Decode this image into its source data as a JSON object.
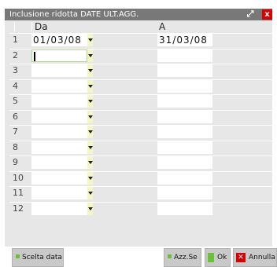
{
  "window": {
    "title": "Inclusione ridotta DATE ULT.AGG.",
    "maximize_glyph": "⤢",
    "close_glyph": "x"
  },
  "columns": {
    "da": "Da",
    "a": "A"
  },
  "rows": [
    {
      "num": "1",
      "da": "01/03/08",
      "a": "31/03/08"
    },
    {
      "num": "2",
      "da": "",
      "a": ""
    },
    {
      "num": "3",
      "da": "",
      "a": ""
    },
    {
      "num": "4",
      "da": "",
      "a": ""
    },
    {
      "num": "5",
      "da": "",
      "a": ""
    },
    {
      "num": "6",
      "da": "",
      "a": ""
    },
    {
      "num": "7",
      "da": "",
      "a": ""
    },
    {
      "num": "8",
      "da": "",
      "a": ""
    },
    {
      "num": "9",
      "da": "",
      "a": ""
    },
    {
      "num": "10",
      "da": "",
      "a": ""
    },
    {
      "num": "11",
      "da": "",
      "a": ""
    },
    {
      "num": "12",
      "da": "",
      "a": ""
    }
  ],
  "buttons": {
    "scelta_data": "Scelta data",
    "azz_se": "Azz.Se",
    "ok": "Ok",
    "annulla": "Annulla"
  },
  "colors": {
    "titlebar": "#787878",
    "panel": "#e7e7e7",
    "accent_green": "#6bbf3a",
    "close_red": "#d80000"
  }
}
